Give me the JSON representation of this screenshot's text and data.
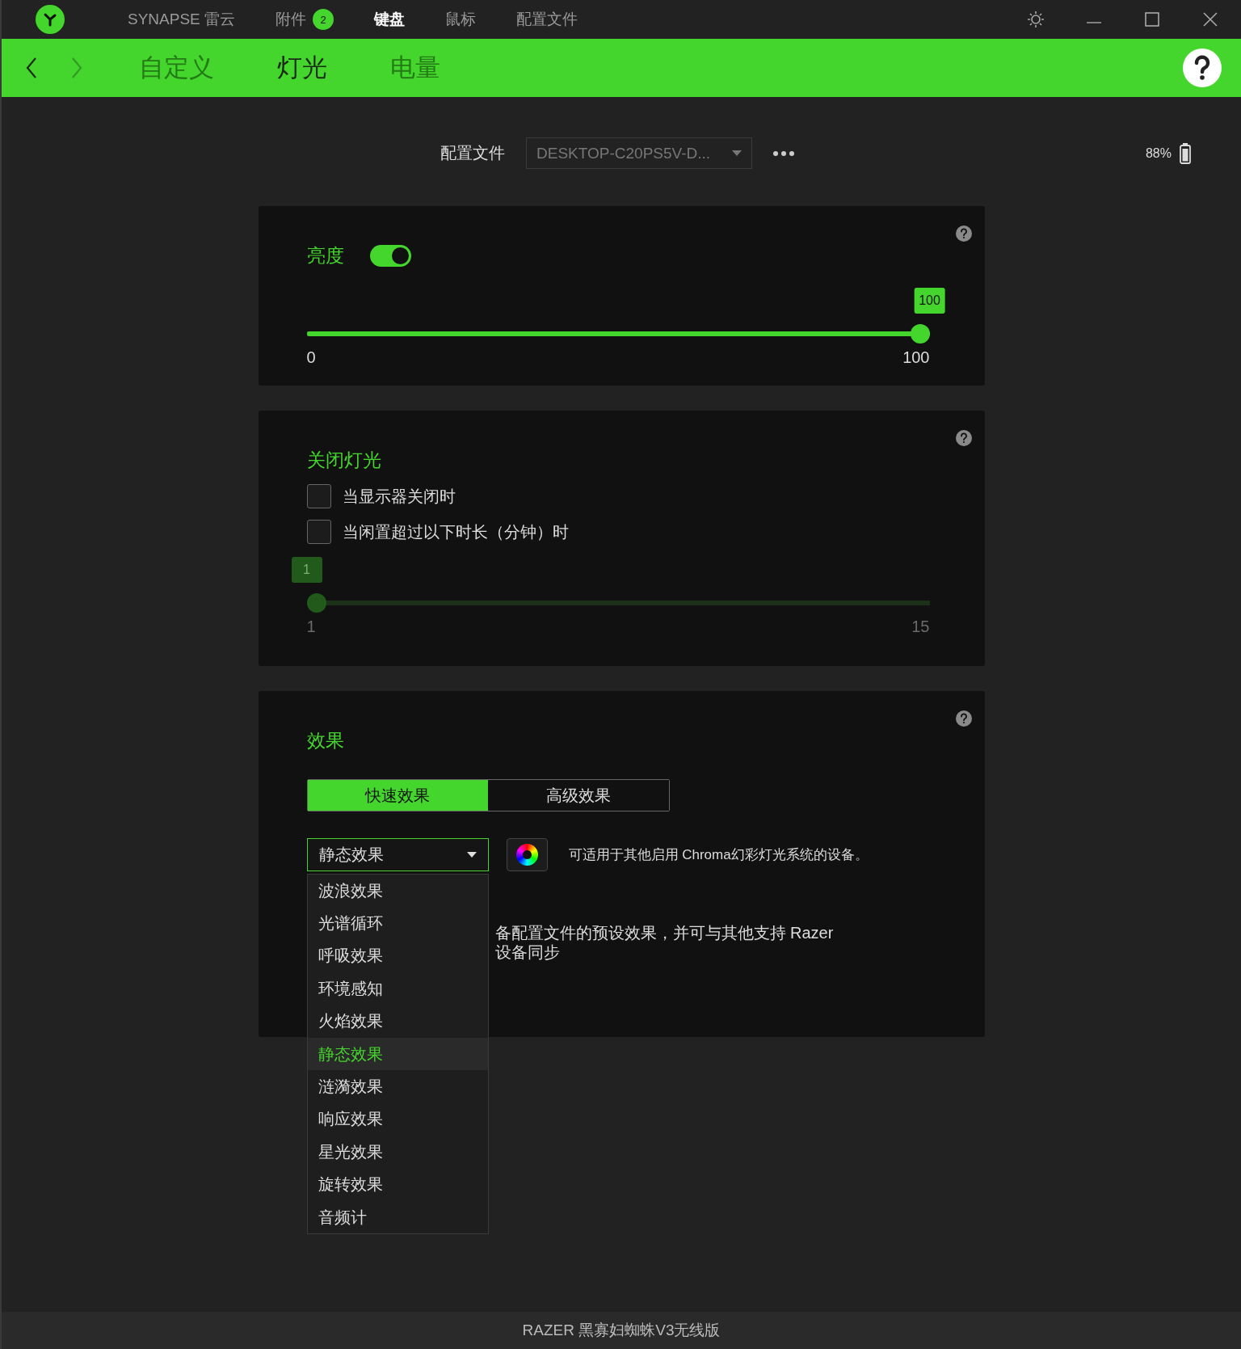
{
  "titlebar": {
    "tabs": [
      {
        "label": "SYNAPSE 雷云",
        "selected": false
      },
      {
        "label": "附件",
        "badge": "2",
        "selected": false
      },
      {
        "label": "键盘",
        "selected": true
      },
      {
        "label": "鼠标",
        "selected": false
      },
      {
        "label": "配置文件",
        "selected": false
      }
    ]
  },
  "subnav": {
    "nav_buttons": [
      {
        "kind": "back",
        "disabled": false
      },
      {
        "kind": "forward",
        "disabled": true
      }
    ],
    "tabs": [
      {
        "label": "自定义",
        "selected": false
      },
      {
        "label": "灯光",
        "selected": true
      },
      {
        "label": "电量",
        "selected": false
      }
    ]
  },
  "profile": {
    "label": "配置文件",
    "value": "DESKTOP-C20PS5V-D...",
    "battery": "88%"
  },
  "brightness": {
    "title": "亮度",
    "on": true,
    "slider": {
      "disabled": false,
      "level": 1,
      "value": "100",
      "min": "0",
      "max": "100"
    }
  },
  "lighting_off": {
    "title": "关闭灯光",
    "options": [
      {
        "label": "当显示器关闭时",
        "checked": false
      },
      {
        "label": "当闲置超过以下时长（分钟）时",
        "checked": false
      }
    ],
    "slider": {
      "disabled": true,
      "level": 0,
      "value": "1",
      "min": "1",
      "max": "15"
    }
  },
  "effects": {
    "title": "效果",
    "tabs": [
      {
        "label": "快速效果",
        "selected": true
      },
      {
        "label": "高级效果",
        "selected": false
      }
    ],
    "select": {
      "value": "静态效果",
      "expanded": true
    },
    "chroma_note": "可适用于其他启用 Chroma幻彩灯光系统的设备。",
    "description_lines": [
      "备配置文件的预设效果，并可与其他支持 Razer",
      "设备同步"
    ],
    "options": [
      {
        "label": "波浪效果",
        "selected": false
      },
      {
        "label": "光谱循环",
        "selected": false
      },
      {
        "label": "呼吸效果",
        "selected": false
      },
      {
        "label": "环境感知",
        "selected": false
      },
      {
        "label": "火焰效果",
        "selected": false
      },
      {
        "label": "静态效果",
        "selected": true
      },
      {
        "label": "涟漪效果",
        "selected": false
      },
      {
        "label": "响应效果",
        "selected": false
      },
      {
        "label": "星光效果",
        "selected": false
      },
      {
        "label": "旋转效果",
        "selected": false
      },
      {
        "label": "音频计",
        "selected": false
      }
    ]
  },
  "footer": {
    "device": "RAZER 黑寡妇蜘蛛V3无线版"
  }
}
